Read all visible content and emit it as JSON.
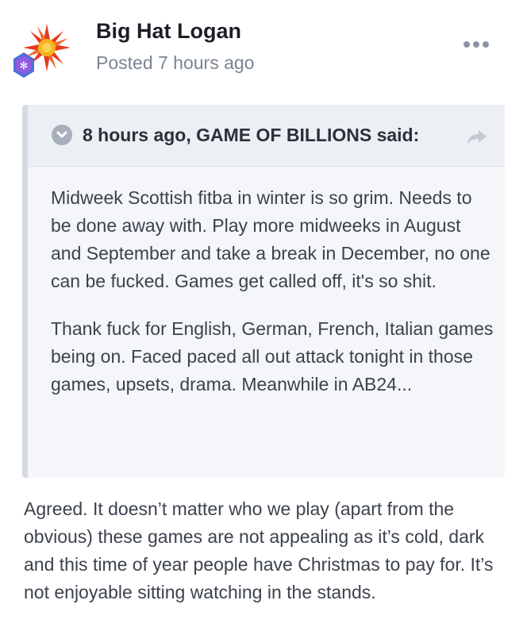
{
  "post": {
    "author": "Big Hat Logan",
    "posted": "Posted 7 hours ago",
    "avatar_icon": "sun-avatar-icon",
    "badge_icon": "rank-badge-icon",
    "menu_icon": "more-options-icon"
  },
  "quote": {
    "citation": "8 hours ago, GAME OF BILLIONS said:",
    "paragraphs": [
      "Midweek Scottish fitba in winter is so grim. Needs to be done away with. Play more midweeks in August and September and take a break in December, no one can be fucked. Games get called off, it's so shit.",
      "Thank fuck for English, German, French, Italian games being on. Faced paced all out attack tonight in those games, upsets, drama. Meanwhile in AB24..."
    ]
  },
  "reply": {
    "text": "Agreed. It doesn’t matter who we play (apart from the obvious) these games are not appealing as it’s cold, dark and this time of year people have Christmas to pay for. It’s not enjoyable sitting watching in the stands."
  },
  "colors": {
    "sun": "#e53a1e",
    "sun_core": "#f6b31b",
    "badge": "#4e6fd8"
  }
}
